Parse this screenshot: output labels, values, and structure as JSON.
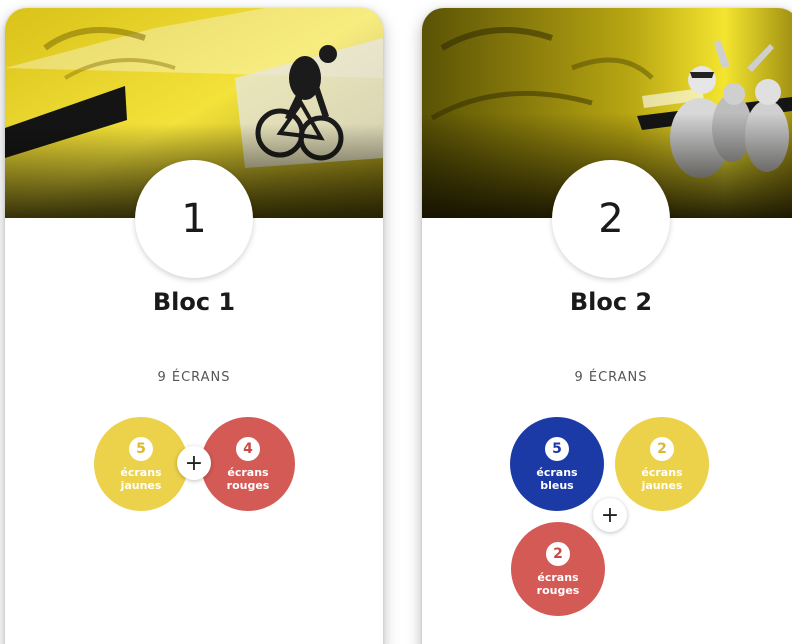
{
  "colors": {
    "yellow": "#ecd14a",
    "red": "#d45a55",
    "blue": "#1c3aa6"
  },
  "blocks": [
    {
      "number": "1",
      "title": "Bloc 1",
      "screens": "9 ÉCRANS",
      "groups": [
        {
          "count": "5",
          "line1": "écrans",
          "line2": "jaunes",
          "color": "yellow"
        },
        {
          "count": "4",
          "line1": "écrans",
          "line2": "rouges",
          "color": "red"
        }
      ],
      "plus": "+"
    },
    {
      "number": "2",
      "title": "Bloc 2",
      "screens": "9 ÉCRANS",
      "groups": [
        {
          "count": "5",
          "line1": "écrans",
          "line2": "bleus",
          "color": "blue"
        },
        {
          "count": "2",
          "line1": "écrans",
          "line2": "jaunes",
          "color": "yellow"
        },
        {
          "count": "2",
          "line1": "écrans",
          "line2": "rouges",
          "color": "red"
        }
      ],
      "plus": "+"
    }
  ]
}
